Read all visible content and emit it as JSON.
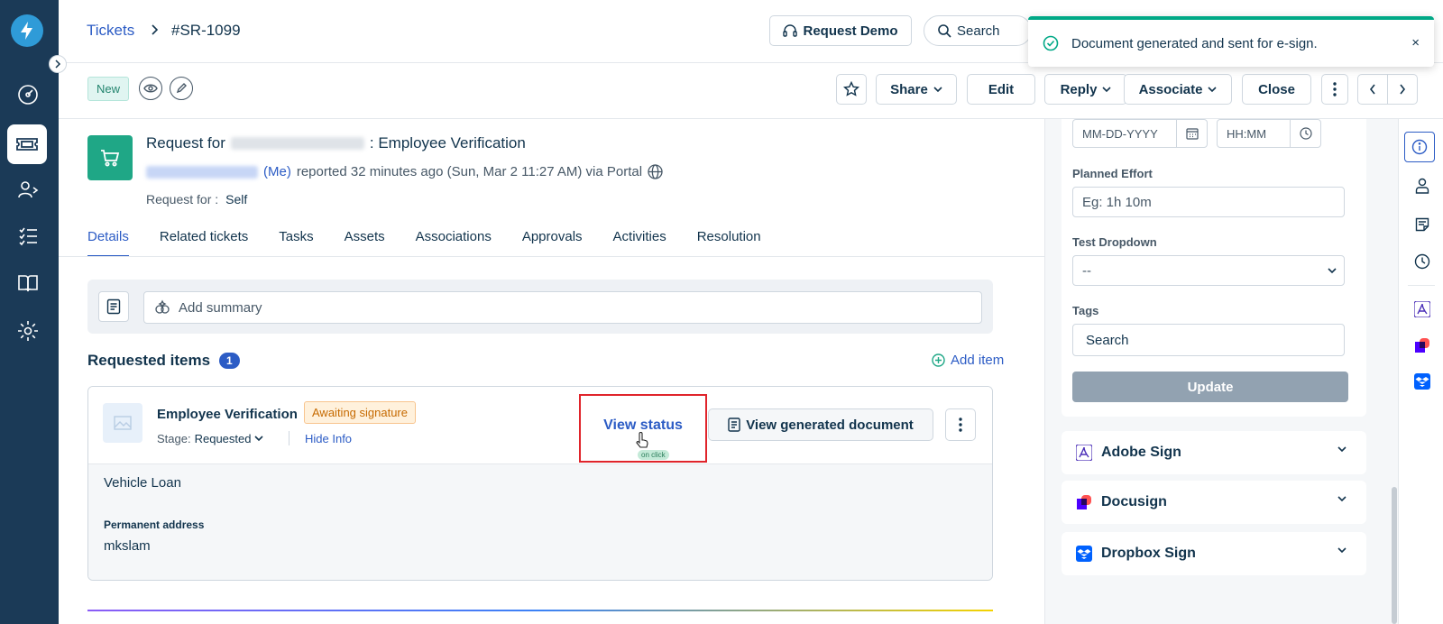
{
  "colors": {
    "nav_bg": "#1b3a57",
    "accent": "#2c5cc5",
    "success": "#00a886",
    "warning_text": "#c66a00",
    "highlight_box": "#e0242b"
  },
  "breadcrumb": {
    "root": "Tickets",
    "ticket_id": "#SR-1099"
  },
  "header": {
    "demo_label": "Request Demo",
    "search_label": "Search"
  },
  "toast": {
    "message": "Document generated and sent for e-sign.",
    "close": "×"
  },
  "toolbar": {
    "status_badge": "New",
    "share": "Share",
    "edit": "Edit",
    "reply": "Reply",
    "associate": "Associate",
    "close": "Close"
  },
  "ticket": {
    "title_prefix": "Request for",
    "title_suffix": ": Employee Verification",
    "me_label": "(Me)",
    "reported_text": "reported 32 minutes ago (Sun, Mar 2 11:27 AM) via Portal",
    "request_for_label": "Request for :",
    "request_for_value": "Self"
  },
  "tabs": [
    "Details",
    "Related tickets",
    "Tasks",
    "Assets",
    "Associations",
    "Approvals",
    "Activities",
    "Resolution"
  ],
  "summary": {
    "placeholder": "Add summary"
  },
  "requested_items": {
    "title": "Requested items",
    "count": "1",
    "add_item": "Add item",
    "item": {
      "name": "Employee Verification",
      "status_badge": "Awaiting signature",
      "stage_label": "Stage:",
      "stage_value": "Requested",
      "hide_info": "Hide Info",
      "view_status": "View status",
      "click_tag": "on click",
      "view_document": "View generated document",
      "field_value_1": "Vehicle Loan",
      "permanent_address_label": "Permanent address",
      "permanent_address_value": "mkslam"
    }
  },
  "properties": {
    "date_placeholder": "MM-DD-YYYY",
    "time_placeholder": "HH:MM",
    "planned_effort_label": "Planned Effort",
    "planned_effort_placeholder": "Eg: 1h 10m",
    "test_dropdown_label": "Test Dropdown",
    "test_dropdown_value": "--",
    "tags_label": "Tags",
    "tags_placeholder": "Search",
    "update": "Update"
  },
  "apps": [
    {
      "name": "Adobe Sign",
      "icon": "adobe-sign-icon"
    },
    {
      "name": "Docusign",
      "icon": "docusign-icon"
    },
    {
      "name": "Dropbox Sign",
      "icon": "dropbox-sign-icon"
    }
  ]
}
